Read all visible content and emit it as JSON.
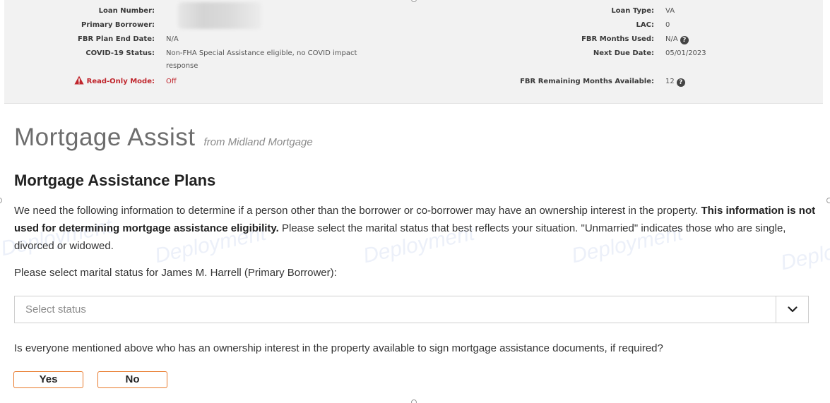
{
  "loan_info": {
    "left": [
      {
        "label": "Loan Number:",
        "value": ""
      },
      {
        "label": "Primary Borrower:",
        "value": ""
      },
      {
        "label": "FBR Plan End Date:",
        "value": "N/A"
      },
      {
        "label": "COVID-19 Status:",
        "value": "Non-FHA Special Assistance eligible, no COVID impact response"
      },
      {
        "label": "Read-Only Mode:",
        "value": "Off"
      }
    ],
    "right": [
      {
        "label": "Loan Type:",
        "value": "VA"
      },
      {
        "label": "LAC:",
        "value": "0"
      },
      {
        "label": "FBR Months Used:",
        "value": "N/A"
      },
      {
        "label": "Next Due Date:",
        "value": "05/01/2023"
      },
      {
        "label": "FBR Remaining Months Available:",
        "value": "12"
      }
    ]
  },
  "brand": {
    "title": "Mortgage Assist",
    "subtitle": "from Midland Mortgage"
  },
  "section": {
    "title": "Mortgage Assistance Plans",
    "intro_part1": "We need the following information to determine if a person other than the borrower or co-borrower may have an ownership interest in the property. ",
    "intro_bold": "This information is not used for determining mortgage assistance eligibility.",
    "intro_part2": " Please select the marital status that best reflects your situation. \"Unmarried\" indicates those who are single, divorced or widowed."
  },
  "marital": {
    "prompt": "Please select marital status for James M. Harrell (Primary Borrower):",
    "placeholder": "Select status"
  },
  "signers": {
    "prompt": "Is everyone mentioned above who has an ownership interest in the property available to sign mortgage assistance documents, if required?",
    "yes_label": "Yes",
    "no_label": "No"
  },
  "watermark": "Deployment",
  "colors": {
    "accent": "#e8792a",
    "warning": "#c0262d",
    "header_bg": "#f2f2f2"
  }
}
